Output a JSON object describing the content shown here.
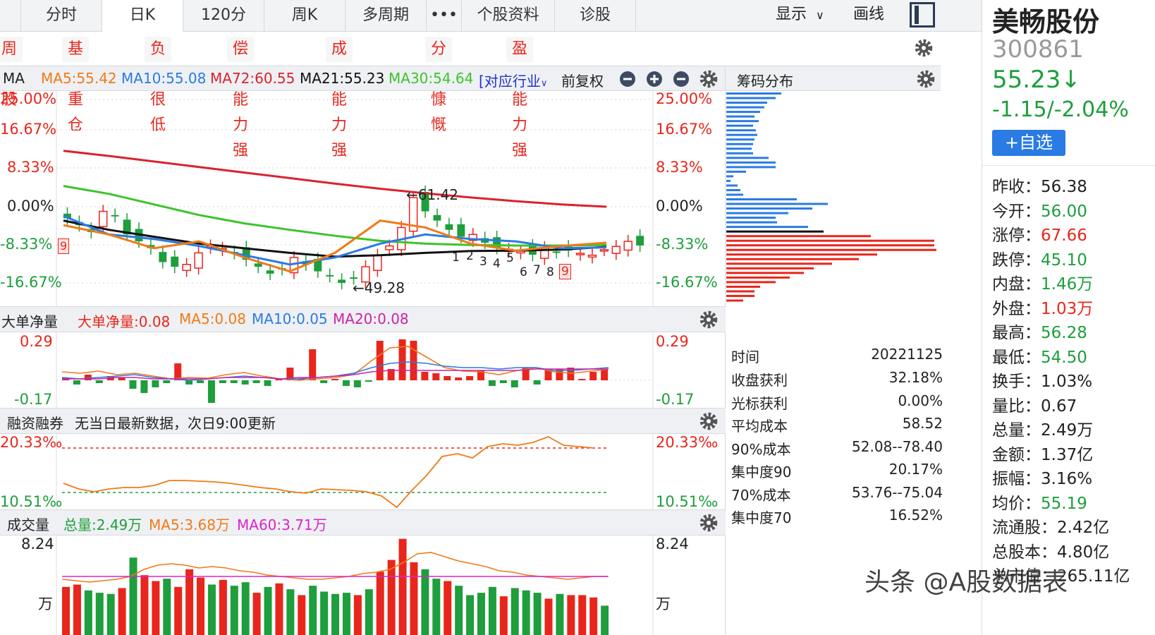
{
  "toolbar": {
    "tabs": [
      "分时",
      "日K",
      "120分",
      "周K",
      "多周期",
      "•••",
      "个股资料",
      "诊股"
    ],
    "active_tab": "日K",
    "display_label": "显示",
    "draw_label": "画线"
  },
  "tags": [
    "周期股",
    "基金重仓",
    "负债很低",
    "偿债能力强",
    "成长能力强",
    "分红慷慨",
    "盈利能力强"
  ],
  "ma_header": {
    "ma_label": "MA",
    "ma5": "MA5:55.42",
    "ma10": "MA10:55.08",
    "ma72": "MA72:60.55",
    "ma21": "MA21:55.23",
    "ma30": "MA30:54.64",
    "industry": "[对应行业",
    "fq": "前复权"
  },
  "price_axis": [
    "25.00%",
    "16.67%",
    "8.33%",
    "0.00%",
    "-8.33%",
    "-16.67%"
  ],
  "price_annotations": {
    "high": "←61.42",
    "low": "←49.28",
    "seq": [
      "1",
      "2",
      "3",
      "4",
      "5",
      "6",
      "7",
      "8",
      "9"
    ],
    "early_nine": "9"
  },
  "chip_panel": {
    "title": "筹码分布",
    "rows": [
      {
        "k": "时间",
        "v": "20221125"
      },
      {
        "k": "收盘获利",
        "v": "32.18%"
      },
      {
        "k": "光标获利",
        "v": "0.00%"
      },
      {
        "k": "平均成本",
        "v": "58.52"
      },
      {
        "k": "90%成本",
        "v": "52.08--78.40"
      },
      {
        "k": "集中度90",
        "v": "20.17%"
      },
      {
        "k": "70%成本",
        "v": "53.76--75.04"
      },
      {
        "k": "集中度70",
        "v": "16.52%"
      }
    ]
  },
  "big_order": {
    "label": "大单净量",
    "val": "大单净量:0.08",
    "ma5": "MA5:0.08",
    "ma10": "MA10:0.05",
    "ma20": "MA20:0.08",
    "axis_top": "0.29",
    "axis_bottom": "-0.17"
  },
  "margin": {
    "label": "融资融券",
    "note": "无当日最新数据，次日9:00更新",
    "axis_top": "20.33‰",
    "axis_bottom": "10.51‰"
  },
  "volume": {
    "label": "成交量",
    "total": "总量:2.49万",
    "ma5": "MA5:3.68万",
    "ma60": "MA60:3.71万",
    "axis_top": "8.24",
    "unit": "万"
  },
  "stock": {
    "name": "美畅股份",
    "code": "300861",
    "price": "55.23↓",
    "change": "-1.15/-2.04%",
    "add_btn": "+自选",
    "fields": [
      {
        "k": "昨收：",
        "v": "56.38",
        "c": "#222"
      },
      {
        "k": "今开：",
        "v": "56.00",
        "c": "#1e9e3c"
      },
      {
        "k": "涨停：",
        "v": "67.66",
        "c": "#e8261c"
      },
      {
        "k": "跌停：",
        "v": "45.10",
        "c": "#1e9e3c"
      },
      {
        "k": "内盘：",
        "v": "1.46万",
        "c": "#1e9e3c"
      },
      {
        "k": "外盘：",
        "v": "1.03万",
        "c": "#e8261c"
      },
      {
        "k": "最高：",
        "v": "56.28",
        "c": "#1e9e3c"
      },
      {
        "k": "最低：",
        "v": "54.50",
        "c": "#1e9e3c"
      },
      {
        "k": "换手：",
        "v": "1.03%",
        "c": "#222"
      },
      {
        "k": "量比：",
        "v": "0.67",
        "c": "#222"
      },
      {
        "k": "总量：",
        "v": "2.49万",
        "c": "#222"
      },
      {
        "k": "金额：",
        "v": "1.37亿",
        "c": "#222"
      },
      {
        "k": "振幅：",
        "v": "3.16%",
        "c": "#222"
      },
      {
        "k": "均价：",
        "v": "55.19",
        "c": "#1e9e3c"
      },
      {
        "k": "流通股：",
        "v": "2.42亿",
        "c": "#222"
      },
      {
        "k": "总股本：",
        "v": "4.80亿",
        "c": "#222"
      },
      {
        "k": "总市值：",
        "v": "265.11亿",
        "c": "#222"
      }
    ]
  },
  "watermark": "头条 @A股数据表",
  "colors": {
    "up": "#e8261c",
    "down": "#1e9e3c",
    "accent": "#2a7be4",
    "ma5": "#f07a16",
    "ma10": "#2a7be4",
    "ma72": "#d9232d",
    "ma21": "#111111",
    "ma30": "#3cc42a"
  },
  "chart_data": [
    {
      "type": "line",
      "title": "",
      "series": [
        {
          "name": "MA72",
          "values": [
            12.1,
            11.0,
            9.8,
            8.6,
            7.4,
            6.2,
            5.0,
            3.9,
            2.9,
            2.0,
            1.2,
            0.5,
            0.0
          ]
        },
        {
          "name": "MA30",
          "values": [
            4.5,
            2.8,
            0.5,
            -1.8,
            -3.6,
            -5.0,
            -6.3,
            -7.4,
            -8.0,
            -8.3,
            -8.4,
            -8.4,
            -8.3
          ]
        },
        {
          "name": "MA21",
          "values": [
            -3.0,
            -5.0,
            -6.5,
            -8.0,
            -9.0,
            -10.0,
            -10.8,
            -10.5,
            -10.0,
            -9.6,
            -9.5,
            -9.3,
            -8.7
          ]
        },
        {
          "name": "MA10",
          "values": [
            -2.0,
            -6.0,
            -7.0,
            -8.5,
            -10.5,
            -12.5,
            -11.0,
            -8.0,
            -6.0,
            -7.0,
            -7.5,
            -9.0,
            -8.8
          ]
        },
        {
          "name": "MA5",
          "values": [
            -4.0,
            -6.0,
            -9.0,
            -7.5,
            -11.0,
            -14.0,
            -10.0,
            -3.0,
            -4.5,
            -8.0,
            -9.5,
            -8.5,
            -7.8
          ]
        }
      ],
      "ylim": [
        -16.67,
        25.0
      ],
      "grid": true,
      "legend": "top-left"
    }
  ]
}
